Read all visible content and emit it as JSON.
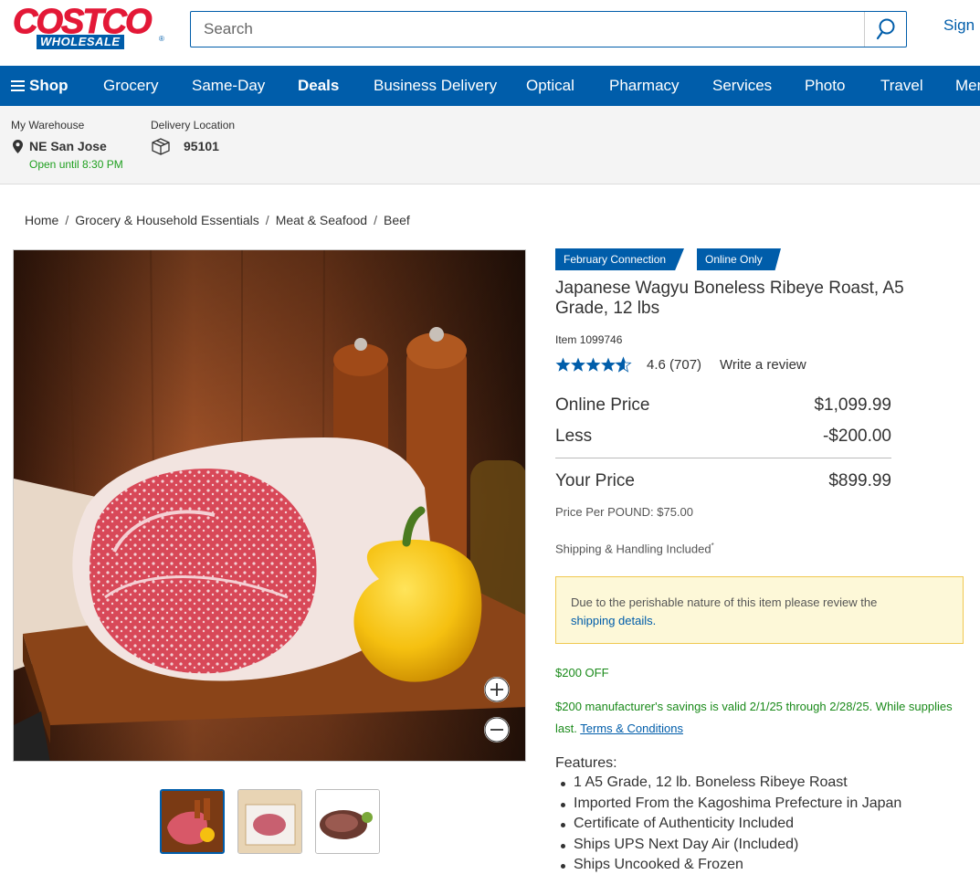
{
  "header": {
    "logo_top": "COSTCO",
    "logo_bottom": "WHOLESALE",
    "search_placeholder": "Search",
    "signin": "Sign In"
  },
  "nav": {
    "shop": "Shop",
    "items": [
      "Grocery",
      "Same-Day",
      "Deals",
      "Business Delivery",
      "Optical",
      "Pharmacy",
      "Services",
      "Photo",
      "Travel",
      "Membership"
    ]
  },
  "location": {
    "warehouse_label": "My Warehouse",
    "warehouse_name": "NE San Jose",
    "warehouse_hours": "Open until 8:30 PM",
    "delivery_label": "Delivery Location",
    "delivery_zip": "95101"
  },
  "breadcrumb": [
    "Home",
    "Grocery & Household Essentials",
    "Meat & Seafood",
    "Beef"
  ],
  "product": {
    "badges": [
      "February Connection",
      "Online Only"
    ],
    "title": "Japanese Wagyu Boneless Ribeye Roast, A5 Grade, 12 lbs",
    "item_label": "Item",
    "item_number": "1099746",
    "rating": 4.6,
    "rating_text": "4.6",
    "review_count": "(707)",
    "write_review": "Write a review",
    "online_price_label": "Online Price",
    "online_price": "$1,099.99",
    "less_label": "Less",
    "less_amount": "-$200.00",
    "your_price_label": "Your Price",
    "your_price": "$899.99",
    "price_per": "Price Per POUND: $75.00",
    "shipping": "Shipping & Handling Included",
    "shipping_mark": "*",
    "notice_text": "Due to the perishable nature of this item please review the",
    "notice_link": "shipping details.",
    "discount": "$200 OFF",
    "promo_text": "$200 manufacturer's savings is valid 2/1/25 through 2/28/25. While supplies last.",
    "promo_link": "Terms & Conditions",
    "features_title": "Features:",
    "features": [
      "1 A5 Grade, 12 lb. Boneless Ribeye Roast",
      "Imported From the Kagoshima Prefecture in Japan",
      "Certificate of Authenticity Included",
      "Ships UPS Next Day Air (Included)",
      "Ships Uncooked & Frozen"
    ]
  },
  "colors": {
    "brand_blue": "#005daa",
    "brand_red": "#e31837",
    "promo_green": "#1a8a1a",
    "notice_bg": "#fdf8d8",
    "notice_border": "#f0c850"
  }
}
